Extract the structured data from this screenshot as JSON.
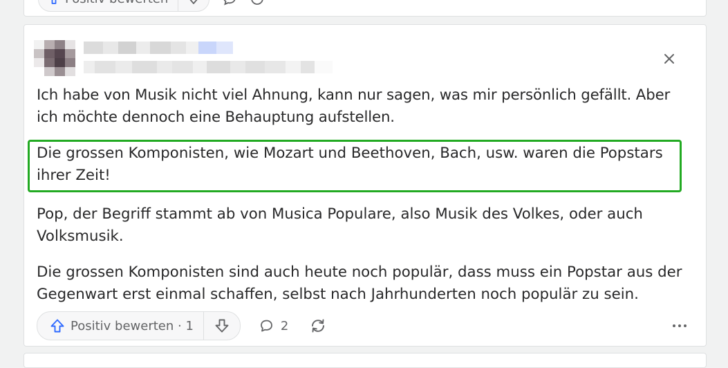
{
  "previous_answer": {
    "upvote_label": "Positiv bewerten"
  },
  "answer": {
    "paragraphs": [
      "Ich habe von Musik nicht viel Ahnung, kann nur sagen, was mir persönlich gefällt. Aber ich möchte dennoch eine Behauptung aufstellen.",
      "Die grossen Komponisten, wie Mozart und Beethoven, Bach, usw. waren die Popstars ihrer Zeit!",
      "Pop, der Begriff stammt ab von Musica Populare, also Musik des Volkes, oder auch Volksmusik.",
      "Die grossen Komponisten sind auch heute noch populär, dass muss ein Popstar aus der Gegenwart erst einmal schaffen, selbst nach Jahrhunderten noch populär zu sein."
    ],
    "upvote_label": "Positiv bewerten · 1",
    "comment_count": "2"
  },
  "colors": {
    "highlight_border": "#22aa22",
    "icon_blue": "#2e69ff",
    "text": "#282829",
    "muted": "#636466"
  }
}
